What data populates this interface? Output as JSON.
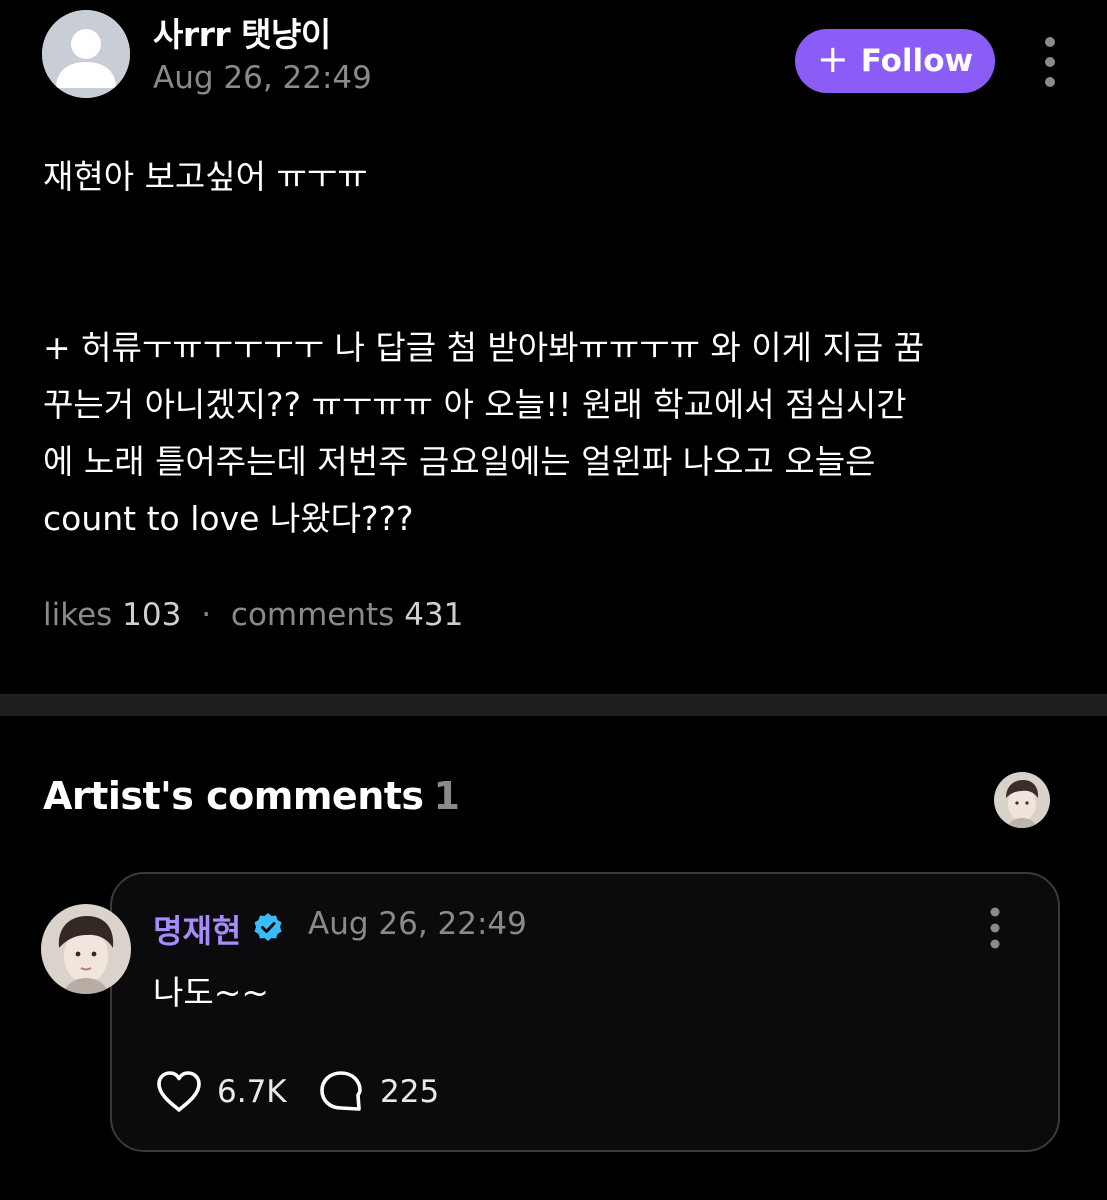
{
  "post": {
    "author": "사rrr 탯냥이",
    "timestamp": "Aug 26, 22:49",
    "follow_label": "Follow",
    "body": "재현아 보고싶어 ㅠㅜㅠ\n\n\n+ 허류ㅜㅠㅜㅜㅜㅜ 나 답글 첨 받아봐ㅠㅠㅜㅠ 와 이게 지금 꿈\n꾸는거 아니겠지?? ㅠㅜㅠㅠ 아 오늘!! 원래 학교에서 점심시간\n에 노래 틀어주는데 저번주 금요일에는 얼윈파 나오고 오늘은\ncount to love 나왔다???",
    "likes_label": "likes",
    "likes_count": "103",
    "comments_label": "comments",
    "comments_count": "431",
    "separator": "·"
  },
  "artist_comments": {
    "heading": "Artist's comments",
    "count": "1",
    "comment": {
      "author": "명재현",
      "timestamp": "Aug 26, 22:49",
      "text": "나도~~",
      "likes": "6.7K",
      "replies": "225"
    }
  },
  "colors": {
    "background": "#000000",
    "accent": "#8b5cf6",
    "artist_name": "#a78bfa",
    "verified": "#38bdf8",
    "muted_text": "#8a8a8e"
  },
  "icons": {
    "more": "vertical-ellipsis-icon",
    "verified": "verified-badge-icon",
    "like": "heart-outline-icon",
    "reply": "speech-bubble-icon",
    "follow": "plus-icon"
  }
}
